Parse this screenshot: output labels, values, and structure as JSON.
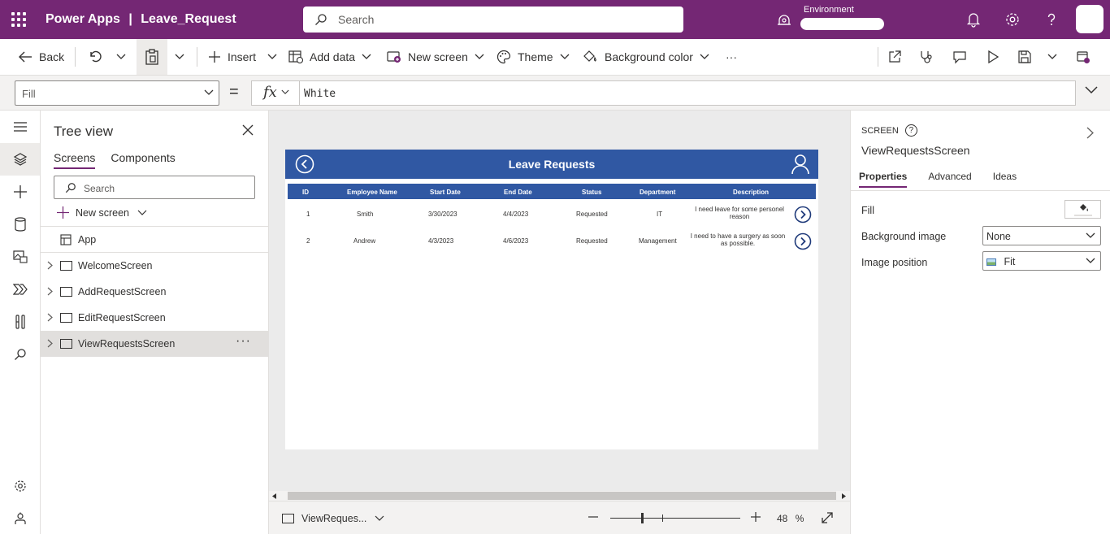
{
  "topbar": {
    "app_name": "Power Apps",
    "separator": "|",
    "file_name": "Leave_Request",
    "search_placeholder": "Search",
    "environment_label": "Environment"
  },
  "commandbar": {
    "back": "Back",
    "insert": "Insert",
    "add_data": "Add data",
    "new_screen": "New screen",
    "theme": "Theme",
    "background_color": "Background color",
    "more": "···"
  },
  "formula": {
    "property": "Fill",
    "equals": "=",
    "fx": "fx",
    "value": "White"
  },
  "tree": {
    "title": "Tree view",
    "tabs": [
      "Screens",
      "Components"
    ],
    "search_placeholder": "Search",
    "new_screen": "New screen",
    "app": "App",
    "screens": [
      "WelcomeScreen",
      "AddRequestScreen",
      "EditRequestScreen",
      "ViewRequestsScreen"
    ],
    "more": "···"
  },
  "canvas": {
    "app_title": "Leave Requests",
    "columns": [
      "ID",
      "Employee Name",
      "Start Date",
      "End Date",
      "Status",
      "Department",
      "Description"
    ],
    "rows": [
      {
        "id": "1",
        "name": "Smith",
        "start": "3/30/2023",
        "end": "4/4/2023",
        "status": "Requested",
        "department": "IT",
        "description": "I need leave for some personel reason"
      },
      {
        "id": "2",
        "name": "Andrew",
        "start": "4/3/2023",
        "end": "4/6/2023",
        "status": "Requested",
        "department": "Management",
        "description": "I need to have a surgery  as soon as possible."
      }
    ],
    "footer_screen": "ViewReques...",
    "zoom_value": "48",
    "zoom_unit": "%"
  },
  "properties": {
    "kind": "SCREEN",
    "help": "?",
    "name": "ViewRequestsScreen",
    "tabs": [
      "Properties",
      "Advanced",
      "Ideas"
    ],
    "fill_label": "Fill",
    "bg_image_label": "Background image",
    "bg_image_value": "None",
    "img_pos_label": "Image position",
    "img_pos_value": "Fit"
  },
  "colors": {
    "brand": "#742774",
    "app_header": "#3058a3",
    "canvas_bg": "#ebebeb"
  }
}
